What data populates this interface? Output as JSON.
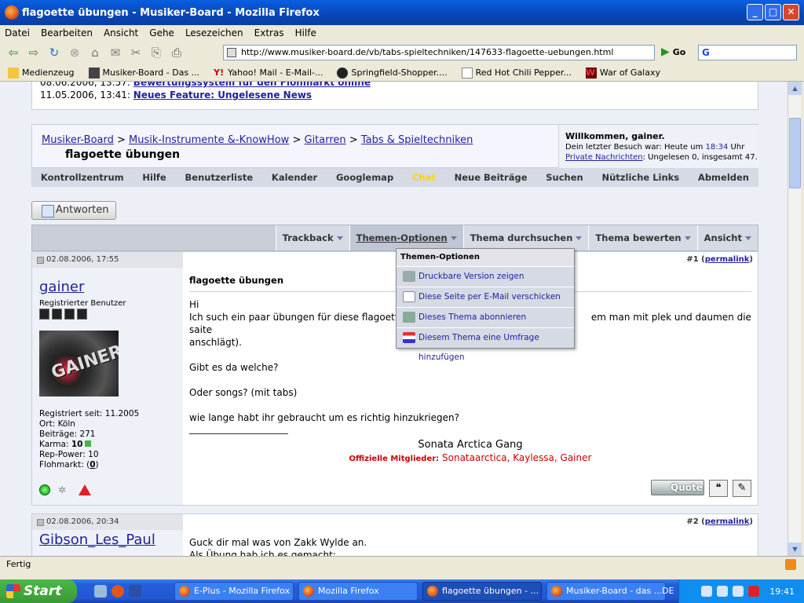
{
  "window": {
    "title": "flagoette übungen - Musiker-Board - Mozilla Firefox"
  },
  "menu": [
    "Datei",
    "Bearbeiten",
    "Ansicht",
    "Gehe",
    "Lesezeichen",
    "Extras",
    "Hilfe"
  ],
  "nav": {
    "url": "http://www.musiker-board.de/vb/tabs-spieltechniken/147633-flagoette-uebungen.html",
    "go": "Go"
  },
  "bookmarks": [
    "Medienzeug",
    "Musiker-Board - Das ...",
    "Yahoo! Mail - E-Mail-...",
    "Springfield-Shopper....",
    "Red Hot Chili Pepper...",
    "War of Galaxy"
  ],
  "news": {
    "row1_date": "08.06.2006, 13:57:",
    "row1_link": "Bewertungssystem für den Flohmarkt online",
    "row2_date": "11.05.2006, 13:41:",
    "row2_link": "Neues Feature: Ungelesene News"
  },
  "breadcrumb": {
    "items": [
      "Musiker-Board",
      "Musik-Instrumente &-KnowHow",
      "Gitarren",
      "Tabs & Spieltechniken"
    ],
    "sep": ">",
    "title": "flagoette übungen"
  },
  "welcome": {
    "greeting": "Willkommen, gainer.",
    "last_visit": "Dein letzter Besuch war: Heute um",
    "last_time": "18:34",
    "uhr": "Uhr",
    "pm_label": "Private Nachrichten",
    "pm_counts": ": Ungelesen 0, insgesamt 47."
  },
  "navrow": [
    "Kontrollzentrum",
    "Hilfe",
    "Benutzerliste",
    "Kalender",
    "Googlemap",
    "Chat",
    "Neue Beiträge",
    "Suchen",
    "Nützliche Links",
    "Abmelden"
  ],
  "reply_btn": "Antworten",
  "thread_tools": [
    "Trackback",
    "Themen-Optionen",
    "Thema durchsuchen",
    "Thema bewerten",
    "Ansicht"
  ],
  "dropdown": {
    "header": "Themen-Optionen",
    "items": [
      "Druckbare Version zeigen",
      "Diese Seite per E-Mail verschicken",
      "Dieses Thema abonnieren",
      "Diesem Thema eine Umfrage hinzufügen"
    ]
  },
  "post1": {
    "date": "02.08.2006, 17:55",
    "num": "#1",
    "permalink": "permalink",
    "user": "gainer",
    "rank": "Registrierter Benutzer",
    "avatar_text": "GAINER",
    "info": [
      "Registriert seit: 11.2005",
      "Ort: Köln",
      "Beiträge: 271",
      "Karma:",
      "10",
      "Rep-Power: 10",
      "Flohmarkt: (",
      "0",
      ")"
    ],
    "title": "flagoette übungen",
    "text": [
      "Hi",
      "Ich such ein paar übungen für diese flagoette",
      "em man mit plek und daumen die saite",
      "anschlägt).",
      "Gibt es da welche?",
      "Oder songs? (mit tabs)",
      "wie lange habt ihr gebraucht um es richtig hinzukriegen?"
    ],
    "sig_gang": "Sonata Arctica Gang",
    "sig_label": "Offizielle Mitglieder:",
    "sig_members": "Sonataarctica, Kaylessa, Gainer",
    "quote": "Quote"
  },
  "post2": {
    "date": "02.08.2006, 20:34",
    "num": "#2",
    "permalink": "permalink",
    "user": "Gibson_Les_Paul",
    "text1": "Guck dir mal was von Zakk Wylde an.",
    "text2": "Als Übung hab ich es gemacht:"
  },
  "status": "Fertig",
  "taskbar": {
    "start": "Start",
    "tasks": [
      "E-Plus - Mozilla Firefox",
      "Mozilla Firefox",
      "flagoette übungen - ...",
      "Musiker-Board - das ..."
    ],
    "lang": "DE",
    "clock": "19:41"
  }
}
